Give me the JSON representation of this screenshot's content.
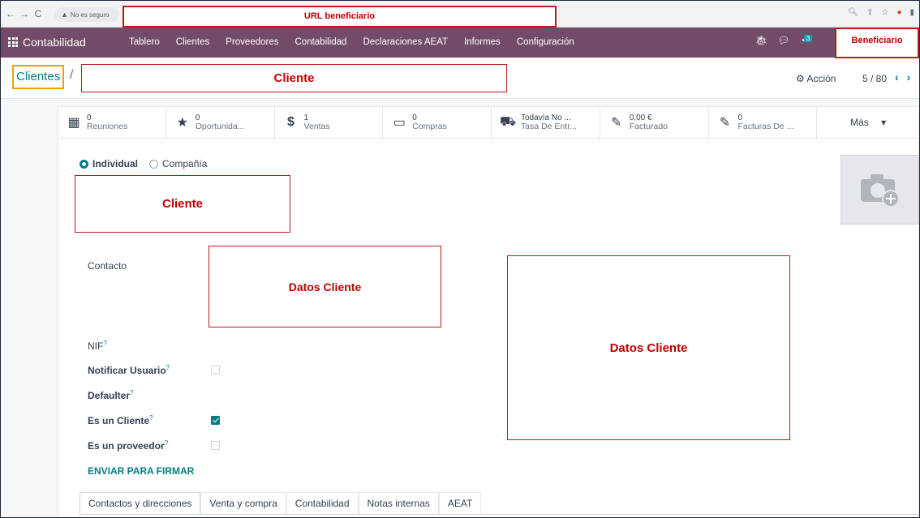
{
  "browser": {
    "security_text": "No es seguro",
    "url_redaction": "URL beneficiario"
  },
  "navbar": {
    "app_name": "Contabilidad",
    "menu": [
      "Tablero",
      "Clientes",
      "Proveedores",
      "Contabilidad",
      "Declaraciones AEAT",
      "Informes",
      "Configuración"
    ],
    "activity_count": "3",
    "user_redaction": "Beneficiario"
  },
  "control_panel": {
    "breadcrumb": "Clientes",
    "separator": "/",
    "record_redaction": "Cliente",
    "action_label": "Acción",
    "pager": "5 / 80"
  },
  "smart_buttons": [
    {
      "icon": "calendar-icon",
      "value": "0",
      "label": "Reuniones"
    },
    {
      "icon": "star-icon",
      "value": "0",
      "label": "Oportunida..."
    },
    {
      "icon": "dollar-icon",
      "value": "1",
      "label": "Ventas"
    },
    {
      "icon": "credit-card-icon",
      "value": "0",
      "label": "Compras"
    },
    {
      "icon": "truck-icon",
      "value": "Todavía No ...",
      "label": "Tasa De Entr..."
    },
    {
      "icon": "edit-icon",
      "value": "0,00 €",
      "label": "Facturado"
    },
    {
      "icon": "edit-icon",
      "value": "0",
      "label": "Facturas De ..."
    }
  ],
  "more_label": "Más",
  "form": {
    "company_type": {
      "individual": "Individual",
      "company": "Compañía",
      "selected": "individual"
    },
    "name_redaction": "Cliente",
    "contact_label": "Contacto",
    "contact_redaction": "Datos Cliente",
    "right_redaction": "Datos Cliente",
    "fields": [
      {
        "label": "NIF",
        "help": "?",
        "type": "text"
      },
      {
        "label": "Notificar Usuario",
        "help": "?",
        "type": "checkbox",
        "checked": false
      },
      {
        "label": "Defaulter",
        "help": "?",
        "type": "text"
      },
      {
        "label": "Es un Cliente",
        "help": "?",
        "type": "checkbox",
        "checked": true
      },
      {
        "label": "Es un proveedor",
        "help": "?",
        "type": "checkbox",
        "checked": false
      }
    ],
    "sign_button": "ENVIAR PARA FIRMAR"
  },
  "tabs": [
    "Contactos y direcciones",
    "Venta y compra",
    "Contabilidad",
    "Notas internas",
    "AEAT"
  ],
  "colors": {
    "brand": "#714b67",
    "accent": "#017e84",
    "redaction": "#c00000"
  }
}
